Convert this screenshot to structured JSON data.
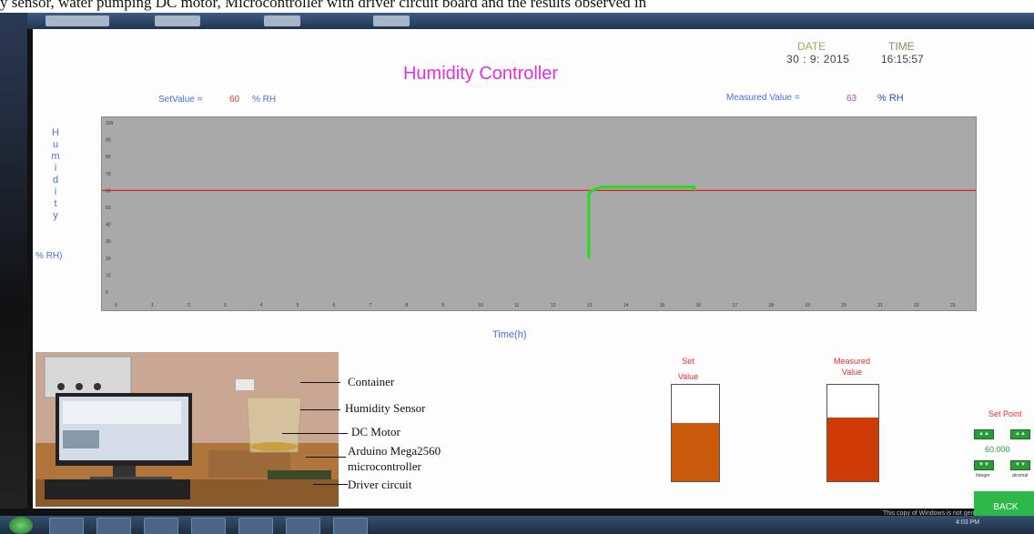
{
  "caption": "y sensor, water pumping DC motor, Microcontroller with driver circuit board and the results observed in",
  "app": {
    "title": "Humidity Controller",
    "date_label": "DATE",
    "date_value": "30 : 9: 2015",
    "time_label": "TIME",
    "time_value": "16:15:57",
    "setvalue_label": "SetValue =",
    "setvalue": "60",
    "setvalue_unit": "% RH",
    "measured_label": "Measured Value =",
    "measured_value": "63",
    "measured_unit": "% RH"
  },
  "chart_data": {
    "type": "line",
    "ylabel_letters": [
      "H",
      "u",
      "m",
      "i",
      "d",
      "i",
      "t",
      "y"
    ],
    "yunit": "% RH)",
    "xlabel": "Time(h)",
    "x_ticks": [
      "0",
      "1",
      "2",
      "3",
      "4",
      "5",
      "6",
      "7",
      "8",
      "9",
      "10",
      "11",
      "12",
      "13",
      "14",
      "15",
      "16",
      "17",
      "18",
      "19",
      "20",
      "21",
      "22",
      "23"
    ],
    "y_ticks": [
      "100",
      "90",
      "80",
      "70",
      "60",
      "50",
      "40",
      "30",
      "20",
      "10",
      "0"
    ],
    "xlim": [
      0,
      23.5
    ],
    "ylim": [
      0,
      100
    ],
    "setpoint": 60,
    "series": [
      {
        "x": [
          13.0,
          13.0,
          13.1,
          13.3,
          15.9,
          15.9
        ],
        "y": [
          20,
          58,
          60,
          62,
          62,
          60
        ]
      }
    ],
    "colors": {
      "background": "#a9a9a9",
      "setpoint_line": "#e02020",
      "series": "#22dd22"
    }
  },
  "photo": {
    "labels": [
      "Container",
      "Humidity Sensor",
      "DC Motor",
      "Arduino Mega2560",
      "microcontroller",
      "Driver circuit"
    ]
  },
  "gauges": {
    "set": {
      "label_line1": "Set",
      "label_line2": "Value",
      "level": 0.6,
      "color": "#c85a0a"
    },
    "measured": {
      "label_line1": "Measured",
      "label_line2": "Value",
      "level": 0.66,
      "color": "#d03a06"
    }
  },
  "setpoint_panel": {
    "title": "Set Point",
    "value": "60.000",
    "btn_label": "▲▲",
    "btn_down_label": "▼▼",
    "small_left": "Integer",
    "small_right": "decimal",
    "back": "BACK"
  },
  "taskbar": {
    "notice": "This copy of Windows is not gen",
    "clock": "4:03 PM"
  }
}
